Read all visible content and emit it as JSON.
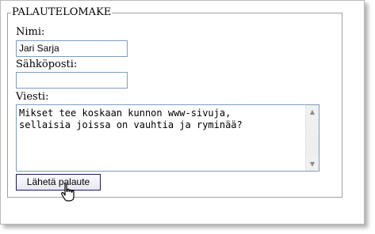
{
  "form": {
    "legend": "PALAUTELOMAKE",
    "name_label": "Nimi:",
    "name_value": "Jari Sarja",
    "email_label": "Sähköposti:",
    "email_value": "",
    "message_label": "Viesti:",
    "message_value": "Mikset tee koskaan kunnon www-sivuja,\nsellaisia joissa on vauhtia ja ryminää?",
    "submit_label": "Lähetä palaute"
  },
  "icons": {
    "cursor": "hand-pointer-icon",
    "scroll_up": "scroll-up-arrow-icon",
    "scroll_down": "scroll-down-arrow-icon"
  }
}
